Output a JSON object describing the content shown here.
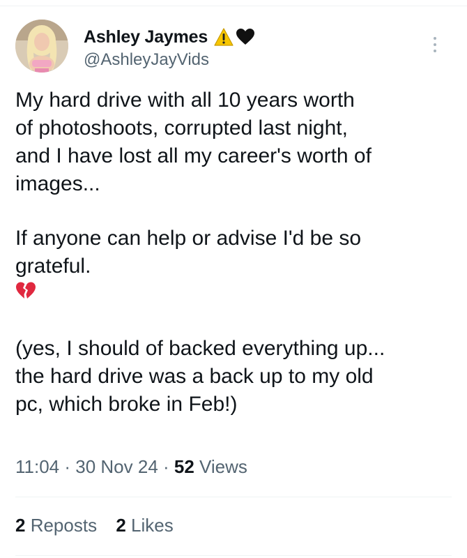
{
  "author": {
    "display_name": "Ashley Jaymes",
    "handle": "@AshleyJayVids",
    "name_icons": [
      "warning-icon",
      "black-heart-icon"
    ],
    "avatar": "profile-photo"
  },
  "tweet": {
    "paragraph_1": "My hard drive with all 10 years worth\nof photoshoots, corrupted last night,\nand I have lost all my career's worth of\nimages...",
    "paragraph_2": "If anyone can help or advise I'd be so\ngrateful.",
    "emoji": "broken-heart-icon",
    "paragraph_3": "(yes, I should of backed everything up...\nthe hard drive was a back up to my old\npc, which broke in Feb!)"
  },
  "meta": {
    "time": "11:04",
    "separator": " · ",
    "date": "30 Nov 24",
    "views_count": "52",
    "views_label": " Views"
  },
  "stats": {
    "reposts_count": "2",
    "reposts_label": " Reposts",
    "likes_count": "2",
    "likes_label": " Likes"
  },
  "colors": {
    "text_primary": "#0f1419",
    "text_secondary": "#536471",
    "divider": "#eff3f4",
    "warning": "#f7c600",
    "heart_black": "#111111",
    "broken_heart": "#e0283f"
  }
}
